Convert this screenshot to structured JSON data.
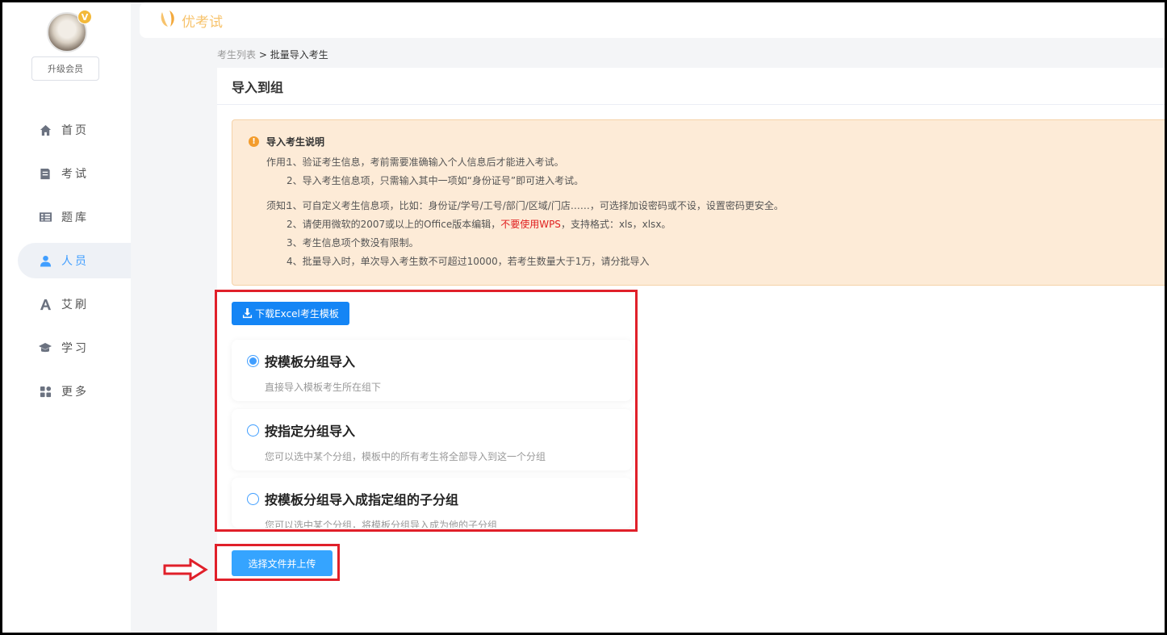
{
  "colors": {
    "primary": "#409eff",
    "download": "#1485f5",
    "upload": "#35a4ff",
    "highlight": "#e0202a",
    "notice_bg": "#fdebd7",
    "logo": "#f7c36c"
  },
  "sidebar": {
    "vip_badge": "V",
    "upgrade_label": "升级会员",
    "items": [
      {
        "label": "首页",
        "icon": "home-icon",
        "active": false
      },
      {
        "label": "考试",
        "icon": "exam-icon",
        "active": false
      },
      {
        "label": "题库",
        "icon": "question-bank-icon",
        "active": false
      },
      {
        "label": "人员",
        "icon": "person-icon",
        "active": true
      },
      {
        "label": "艾刷",
        "icon": "letter-a-icon",
        "active": false
      },
      {
        "label": "学习",
        "icon": "graduation-cap-icon",
        "active": false
      },
      {
        "label": "更多",
        "icon": "grid-icon",
        "active": false
      }
    ]
  },
  "header": {
    "logo_text": "优考试"
  },
  "breadcrumb": {
    "parent": "考生列表",
    "separator": ">",
    "current": "批量导入考生"
  },
  "page": {
    "title": "导入到组"
  },
  "notice": {
    "title": "导入考生说明",
    "usage_label": "作用:",
    "usage": [
      "1、验证考生信息，考前需要准确输入个人信息后才能进入考试。",
      "2、导入考生信息项，只需输入其中一项如“身份证号”即可进入考试。"
    ],
    "rules_label": "须知:",
    "rule1": "1、可自定义考生信息项，比如：身份证/学号/工号/部门/区域/门店……，可选择加设密码或不设，设置密码更安全。",
    "rule2_pre": "2、请使用微软的2007或以上的Office版本编辑，",
    "rule2_warn": "不要使用WPS",
    "rule2_post": "，支持格式：xls，xlsx。",
    "rule3": "3、考生信息项个数没有限制。",
    "rule4": "4、批量导入时，单次导入考生数不可超过10000，若考生数量大于1万，请分批导入"
  },
  "download_label": "下载Excel考生模板",
  "options": [
    {
      "title": "按模板分组导入",
      "desc": "直接导入模板考生所在组下",
      "checked": true
    },
    {
      "title": "按指定分组导入",
      "desc": "您可以选中某个分组，模板中的所有考生将全部导入到这一个分组",
      "checked": false
    },
    {
      "title": "按模板分组导入成指定组的子分组",
      "desc": "您可以选中某个分组，将模板分组导入成为他的子分组",
      "checked": false
    }
  ],
  "upload_label": "选择文件并上传"
}
